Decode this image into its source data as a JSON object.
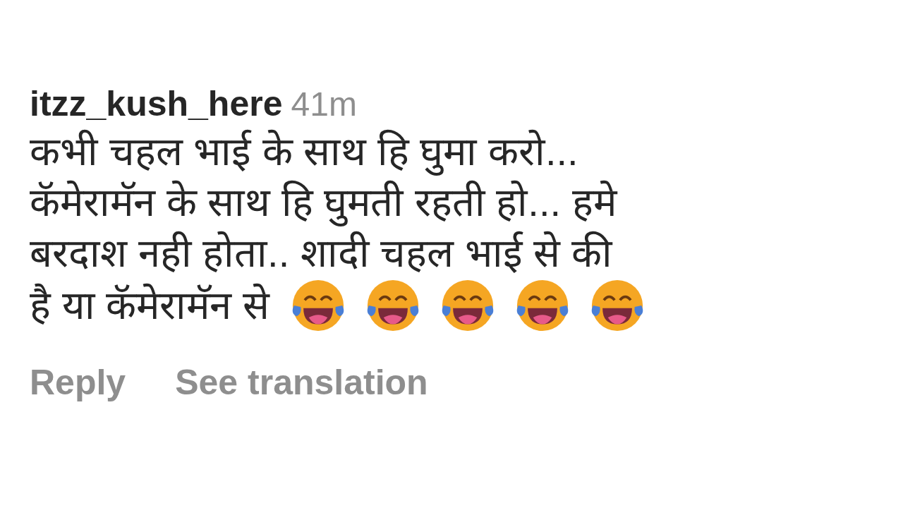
{
  "comment": {
    "username": "itzz_kush_here",
    "time": "41m",
    "lines": [
      "कभी चहल भाई के साथ हि घुमा करो...",
      "कॅमेरामॅन के साथ हि घुमती रहती हो... हमे",
      "बरदाश नही होता.. शादी चहल भाई से की",
      "है या कॅमेरामॅन से"
    ],
    "actions": [
      "Reply",
      "See translation"
    ]
  }
}
